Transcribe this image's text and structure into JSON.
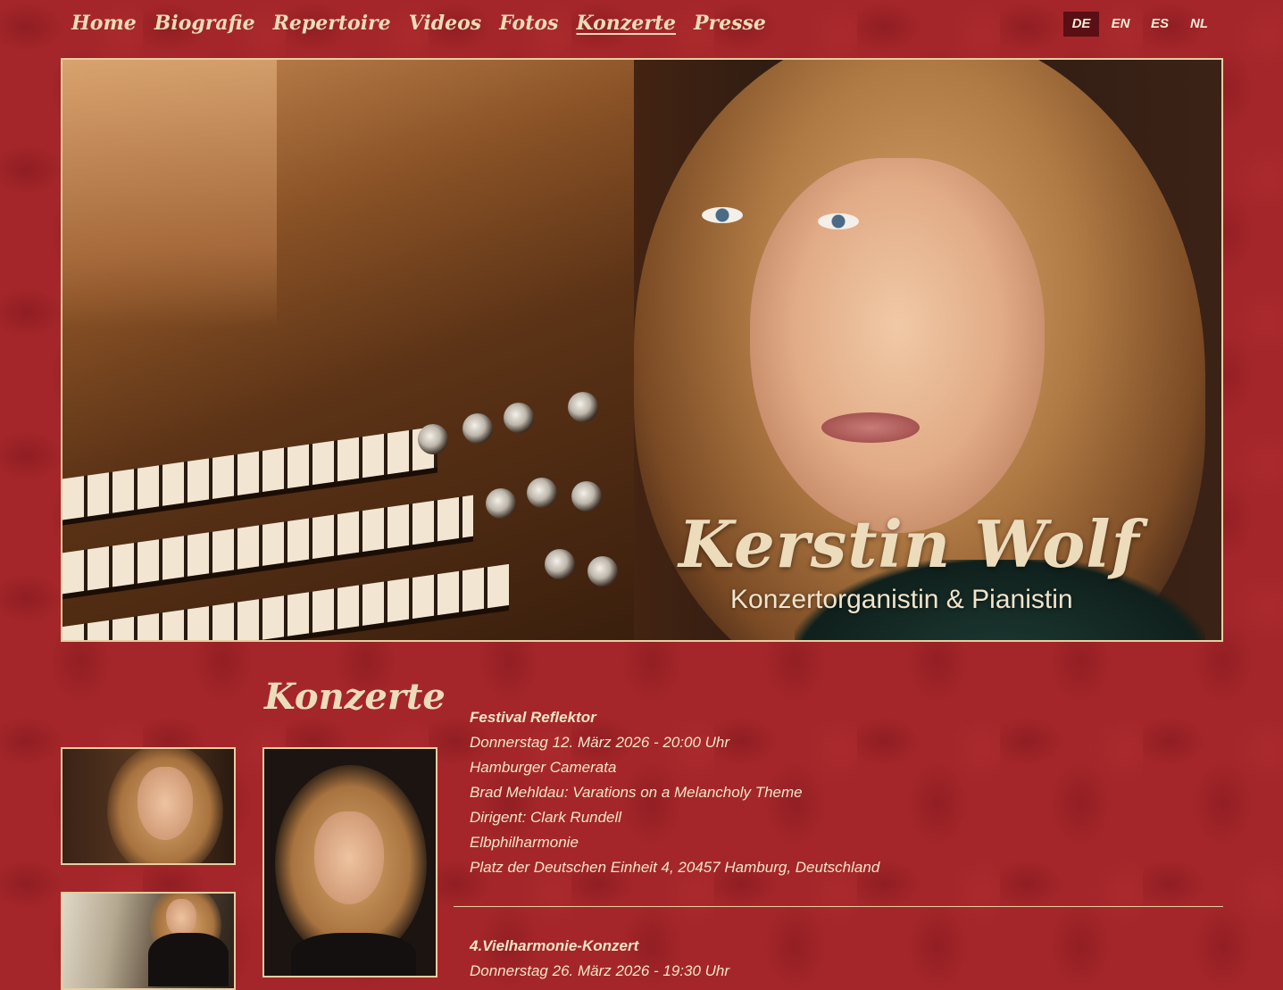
{
  "nav": {
    "items": [
      {
        "label": "Home"
      },
      {
        "label": "Biografie"
      },
      {
        "label": "Repertoire"
      },
      {
        "label": "Videos"
      },
      {
        "label": "Fotos"
      },
      {
        "label": "Konzerte",
        "active": true
      },
      {
        "label": "Presse"
      }
    ]
  },
  "languages": [
    {
      "code": "DE",
      "active": true
    },
    {
      "code": "EN"
    },
    {
      "code": "ES"
    },
    {
      "code": "NL"
    }
  ],
  "hero": {
    "name": "Kerstin Wolf",
    "subtitle": "Konzertorganistin & Pianistin"
  },
  "page": {
    "title": "Konzerte"
  },
  "events": [
    {
      "title": "Festival Reflektor",
      "date": "Donnerstag 12. März 2026 - 20:00 Uhr",
      "ensemble": "Hamburger Camerata",
      "program": "Brad Mehldau: Varations on a Melancholy Theme",
      "conductor": "Dirigent: Clark Rundell",
      "venue": "Elbphilharmonie",
      "address": "Platz der Deutschen Einheit 4, 20457 Hamburg, Deutschland"
    },
    {
      "title": "4.Vielharmonie-Konzert",
      "date": "Donnerstag 26. März 2026 - 19:30 Uhr"
    }
  ],
  "colors": {
    "background": "#a4262a",
    "text": "#f3e6c8",
    "border": "#e6cfa2",
    "active_lang": "#5a0f14"
  }
}
